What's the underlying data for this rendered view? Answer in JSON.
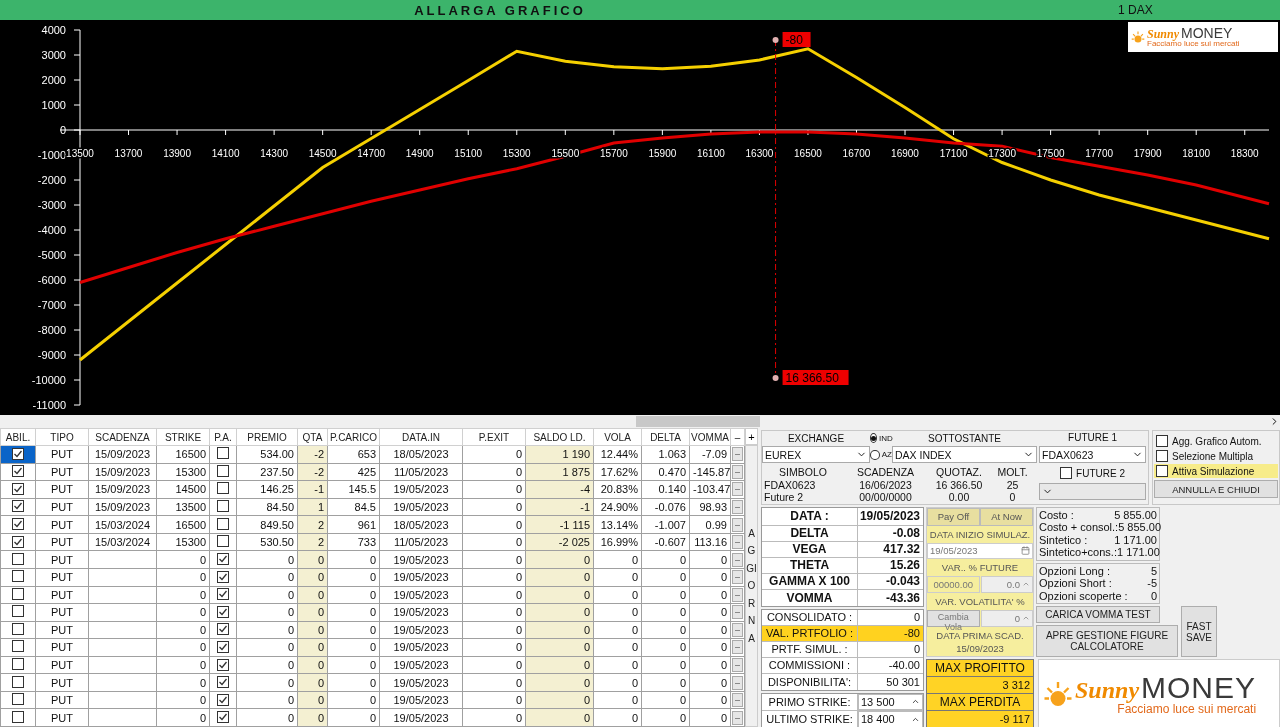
{
  "header": {
    "button": "ALLARGA GRAFICO",
    "instrument": "1 DAX"
  },
  "chart": {
    "logo": {
      "brand": "Sunny",
      "name": "MONEY",
      "tagline": "Facciamo luce sui mercati"
    },
    "chart_data": {
      "type": "line",
      "x": [
        13500,
        13700,
        13900,
        14100,
        14300,
        14500,
        14700,
        14900,
        15100,
        15300,
        15500,
        15700,
        15900,
        16100,
        16300,
        16500,
        16700,
        16900,
        17100,
        17300,
        17500,
        17700,
        17900,
        18100,
        18300,
        18400
      ],
      "series": [
        {
          "color": "#f5d000",
          "values": [
            -9200,
            -7660,
            -6120,
            -4580,
            -3040,
            -1500,
            -340,
            820,
            1980,
            3150,
            2750,
            2530,
            2450,
            2550,
            2800,
            3250,
            2100,
            900,
            -350,
            -1300,
            -2000,
            -2600,
            -3100,
            -3600,
            -4100,
            -4350
          ]
        },
        {
          "color": "#e00000",
          "values": [
            -6100,
            -5500,
            -4900,
            -4350,
            -3850,
            -3350,
            -2850,
            -2400,
            -1950,
            -1550,
            -1050,
            -520,
            -320,
            -160,
            -80,
            -80,
            -160,
            -320,
            -520,
            -650,
            -1100,
            -1450,
            -1800,
            -2200,
            -2700,
            -2950
          ]
        }
      ],
      "xlim": [
        13500,
        18400
      ],
      "ylim": [
        -11000,
        4000
      ],
      "xticks": [
        13500,
        13700,
        13900,
        14100,
        14300,
        14500,
        14700,
        14900,
        15100,
        15300,
        15500,
        15700,
        15900,
        16100,
        16300,
        16500,
        16700,
        16900,
        17100,
        17300,
        17500,
        17700,
        17900,
        18100,
        18300
      ],
      "yticks": [
        4000,
        3000,
        2000,
        1000,
        0,
        -1000,
        -2000,
        -3000,
        -4000,
        -5000,
        -6000,
        -7000,
        -8000,
        -9000,
        -10000,
        -11000
      ],
      "ref_lines": [
        {
          "axis": "x",
          "value": 16366.5,
          "color": "#e00000"
        }
      ],
      "annotations": [
        {
          "x": 16366.5,
          "text": "-80"
        },
        {
          "x": 16366.5,
          "text": "16 366.50"
        }
      ]
    }
  },
  "positions": {
    "columns": [
      "ABIL.",
      "TIPO",
      "SCADENZA",
      "STRIKE",
      "P.A.",
      "PREMIO",
      "QTA",
      "P.CARICO",
      "DATA.IN",
      "P.EXIT",
      "SALDO LD.",
      "VOLA",
      "DELTA",
      "VOMMA",
      "–"
    ],
    "add_button": "+",
    "refresh_button": "AGGIORNA",
    "rows": [
      {
        "selected": true,
        "abil": true,
        "tipo": "PUT",
        "scadenza": "15/09/2023",
        "strike": "16500",
        "pa": false,
        "premio": "534.00",
        "qta": "-2",
        "p_carico": "653",
        "data_in": "18/05/2023",
        "p_exit": "0",
        "saldo": "1 190",
        "vola": "12.44%",
        "delta": "1.063",
        "vomma": "-7.09",
        "action": "–"
      },
      {
        "selected": false,
        "abil": true,
        "tipo": "PUT",
        "scadenza": "15/09/2023",
        "strike": "15300",
        "pa": false,
        "premio": "237.50",
        "qta": "-2",
        "p_carico": "425",
        "data_in": "11/05/2023",
        "p_exit": "0",
        "saldo": "1 875",
        "vola": "17.62%",
        "delta": "0.470",
        "vomma": "-145.87",
        "action": "–"
      },
      {
        "selected": false,
        "abil": true,
        "tipo": "PUT",
        "scadenza": "15/09/2023",
        "strike": "14500",
        "pa": false,
        "premio": "146.25",
        "qta": "-1",
        "p_carico": "145.5",
        "data_in": "19/05/2023",
        "p_exit": "0",
        "saldo": "-4",
        "vola": "20.83%",
        "delta": "0.140",
        "vomma": "-103.47",
        "action": "–"
      },
      {
        "selected": false,
        "abil": true,
        "tipo": "PUT",
        "scadenza": "15/09/2023",
        "strike": "13500",
        "pa": false,
        "premio": "84.50",
        "qta": "1",
        "p_carico": "84.5",
        "data_in": "19/05/2023",
        "p_exit": "0",
        "saldo": "-1",
        "vola": "24.90%",
        "delta": "-0.076",
        "vomma": "98.93",
        "action": "–"
      },
      {
        "selected": false,
        "abil": true,
        "tipo": "PUT",
        "scadenza": "15/03/2024",
        "strike": "16500",
        "pa": false,
        "premio": "849.50",
        "qta": "2",
        "p_carico": "961",
        "data_in": "18/05/2023",
        "p_exit": "0",
        "saldo": "-1 115",
        "vola": "13.14%",
        "delta": "-1.007",
        "vomma": "0.99",
        "action": "–"
      },
      {
        "selected": false,
        "abil": true,
        "tipo": "PUT",
        "scadenza": "15/03/2024",
        "strike": "15300",
        "pa": false,
        "premio": "530.50",
        "qta": "2",
        "p_carico": "733",
        "data_in": "11/05/2023",
        "p_exit": "0",
        "saldo": "-2 025",
        "vola": "16.99%",
        "delta": "-0.607",
        "vomma": "113.16",
        "action": "–"
      },
      {
        "selected": false,
        "abil": false,
        "tipo": "PUT",
        "strike": "0",
        "pa": true,
        "premio": "0",
        "qta": "0",
        "p_carico": "0",
        "data_in": "19/05/2023",
        "p_exit": "0",
        "saldo": "0",
        "vola": "0",
        "delta": "0",
        "vomma": "0",
        "action": "–"
      },
      {
        "selected": false,
        "abil": false,
        "tipo": "PUT",
        "strike": "0",
        "pa": true,
        "premio": "0",
        "qta": "0",
        "p_carico": "0",
        "data_in": "19/05/2023",
        "p_exit": "0",
        "saldo": "0",
        "vola": "0",
        "delta": "0",
        "vomma": "0",
        "action": "–"
      },
      {
        "selected": false,
        "abil": false,
        "tipo": "PUT",
        "strike": "0",
        "pa": true,
        "premio": "0",
        "qta": "0",
        "p_carico": "0",
        "data_in": "19/05/2023",
        "p_exit": "0",
        "saldo": "0",
        "vola": "0",
        "delta": "0",
        "vomma": "0",
        "action": "–"
      },
      {
        "selected": false,
        "abil": false,
        "tipo": "PUT",
        "strike": "0",
        "pa": true,
        "premio": "0",
        "qta": "0",
        "p_carico": "0",
        "data_in": "19/05/2023",
        "p_exit": "0",
        "saldo": "0",
        "vola": "0",
        "delta": "0",
        "vomma": "0",
        "action": "–"
      },
      {
        "selected": false,
        "abil": false,
        "tipo": "PUT",
        "strike": "0",
        "pa": true,
        "premio": "0",
        "qta": "0",
        "p_carico": "0",
        "data_in": "19/05/2023",
        "p_exit": "0",
        "saldo": "0",
        "vola": "0",
        "delta": "0",
        "vomma": "0",
        "action": "–"
      },
      {
        "selected": false,
        "abil": false,
        "tipo": "PUT",
        "strike": "0",
        "pa": true,
        "premio": "0",
        "qta": "0",
        "p_carico": "0",
        "data_in": "19/05/2023",
        "p_exit": "0",
        "saldo": "0",
        "vola": "0",
        "delta": "0",
        "vomma": "0",
        "action": "–"
      },
      {
        "selected": false,
        "abil": false,
        "tipo": "PUT",
        "strike": "0",
        "pa": true,
        "premio": "0",
        "qta": "0",
        "p_carico": "0",
        "data_in": "19/05/2023",
        "p_exit": "0",
        "saldo": "0",
        "vola": "0",
        "delta": "0",
        "vomma": "0",
        "action": "–"
      },
      {
        "selected": false,
        "abil": false,
        "tipo": "PUT",
        "strike": "0",
        "pa": true,
        "premio": "0",
        "qta": "0",
        "p_carico": "0",
        "data_in": "19/05/2023",
        "p_exit": "0",
        "saldo": "0",
        "vola": "0",
        "delta": "0",
        "vomma": "0",
        "action": "–"
      },
      {
        "selected": false,
        "abil": false,
        "tipo": "PUT",
        "strike": "0",
        "pa": true,
        "premio": "0",
        "qta": "0",
        "p_carico": "0",
        "data_in": "19/05/2023",
        "p_exit": "0",
        "saldo": "0",
        "vola": "0",
        "delta": "0",
        "vomma": "0",
        "action": "–"
      },
      {
        "selected": false,
        "abil": false,
        "tipo": "PUT",
        "strike": "0",
        "pa": true,
        "premio": "0",
        "qta": "0",
        "p_carico": "0",
        "data_in": "19/05/2023",
        "p_exit": "0",
        "saldo": "0",
        "vola": "0",
        "delta": "0",
        "vomma": "0",
        "action": "–"
      }
    ]
  },
  "exchange": {
    "exchange_label": "EXCHANGE",
    "exchange_value": "EUREX",
    "market_type": [
      {
        "label": "IND",
        "selected": true
      },
      {
        "label": "AZ",
        "selected": false
      }
    ],
    "underlying_label": "SOTTOSTANTE",
    "underlying_value": "DAX INDEX",
    "future1_label": "FUTURE 1",
    "future1_value": "FDAX0623",
    "future2": {
      "label": "FUTURE 2",
      "checked": false
    },
    "symbol_columns": [
      "SIMBOLO",
      "SCADENZA",
      "QUOTAZ.",
      "MOLT."
    ],
    "symbols": [
      [
        "FDAX0623",
        "16/06/2023",
        "16 366.50",
        "25"
      ],
      [
        "Future 2",
        "00/00/0000",
        "0.00",
        "0"
      ]
    ]
  },
  "options_checks": [
    {
      "label": "Agg. Grafico Autom.",
      "checked": false,
      "highlighted": false
    },
    {
      "label": "Selezione Multipla",
      "checked": false,
      "highlighted": false
    },
    {
      "label": "Attiva Simulazione",
      "checked": false,
      "highlighted": true
    }
  ],
  "close_button": "ANNULLA E CHIUDI",
  "greeks": [
    {
      "label": "DATA :",
      "value": "19/05/2023"
    },
    {
      "label": "DELTA",
      "value": "-0.08"
    },
    {
      "label": "VEGA",
      "value": "417.32"
    },
    {
      "label": "THETA",
      "value": "15.26"
    },
    {
      "label": "GAMMA X 100",
      "value": "-0.043"
    },
    {
      "label": "VOMMA",
      "value": "-43.36"
    }
  ],
  "simulation": {
    "tabs": [
      {
        "label": "Pay Off",
        "selected": false
      },
      {
        "label": "At Now",
        "selected": false
      }
    ],
    "start_label": "DATA INIZIO SIMULAZ.",
    "start_date": "19/05/2023",
    "future_label": "VAR.. % FUTURE",
    "future_value": "00000.00",
    "future_step": "0.0",
    "vola_label": "VAR. VOLATILITA' %",
    "vola_button": "Cambia Vola",
    "vola_step": "0",
    "first_expiry_label": "DATA PRIMA SCAD.",
    "first_expiry": "15/09/2023"
  },
  "portfolio": [
    {
      "label": "CONSOLIDATO :",
      "value": "0",
      "highlighted": false
    },
    {
      "label": "VAL. PRTFOLIO :",
      "value": "-80",
      "highlighted": true
    },
    {
      "label": "PRTF. SIMUL. :",
      "value": "0",
      "highlighted": false
    },
    {
      "label": "COMMISSIONI :",
      "value": "-40.00",
      "highlighted": false
    },
    {
      "label": "DISPONIBILITA':",
      "value": "50 301",
      "highlighted": false
    }
  ],
  "strikes": [
    {
      "label": "PRIMO STRIKE:",
      "value": "13 500"
    },
    {
      "label": "ULTIMO STRIKE:",
      "value": "18 400"
    }
  ],
  "extremes": [
    {
      "label": "MAX PROFITTO",
      "value": "3 312"
    },
    {
      "label": "MAX PERDITA",
      "value": "-9 117"
    }
  ],
  "costs": [
    {
      "label": "Costo :",
      "value": "5 855.00"
    },
    {
      "label": "Costo + consol.:",
      "value": "5 855.00"
    },
    {
      "label": "Sintetico :",
      "value": "1 171.00"
    },
    {
      "label": "Sintetico+cons.:",
      "value": "1 171.00"
    }
  ],
  "counts": [
    {
      "label": "Opzioni Long :",
      "value": "5"
    },
    {
      "label": "Opzioni Short :",
      "value": "-5"
    },
    {
      "label": "Opzioni scoperte :",
      "value": "0"
    }
  ],
  "actions": {
    "vomma_test": "CARICA VOMMA TEST",
    "figures": "APRE GESTIONE FIGURE CALCOLATORE",
    "fast_save": "FAST SAVE"
  },
  "logo": {
    "brand": "Sunny",
    "name": "MONEY",
    "tagline": "Facciamo luce sui mercati"
  }
}
